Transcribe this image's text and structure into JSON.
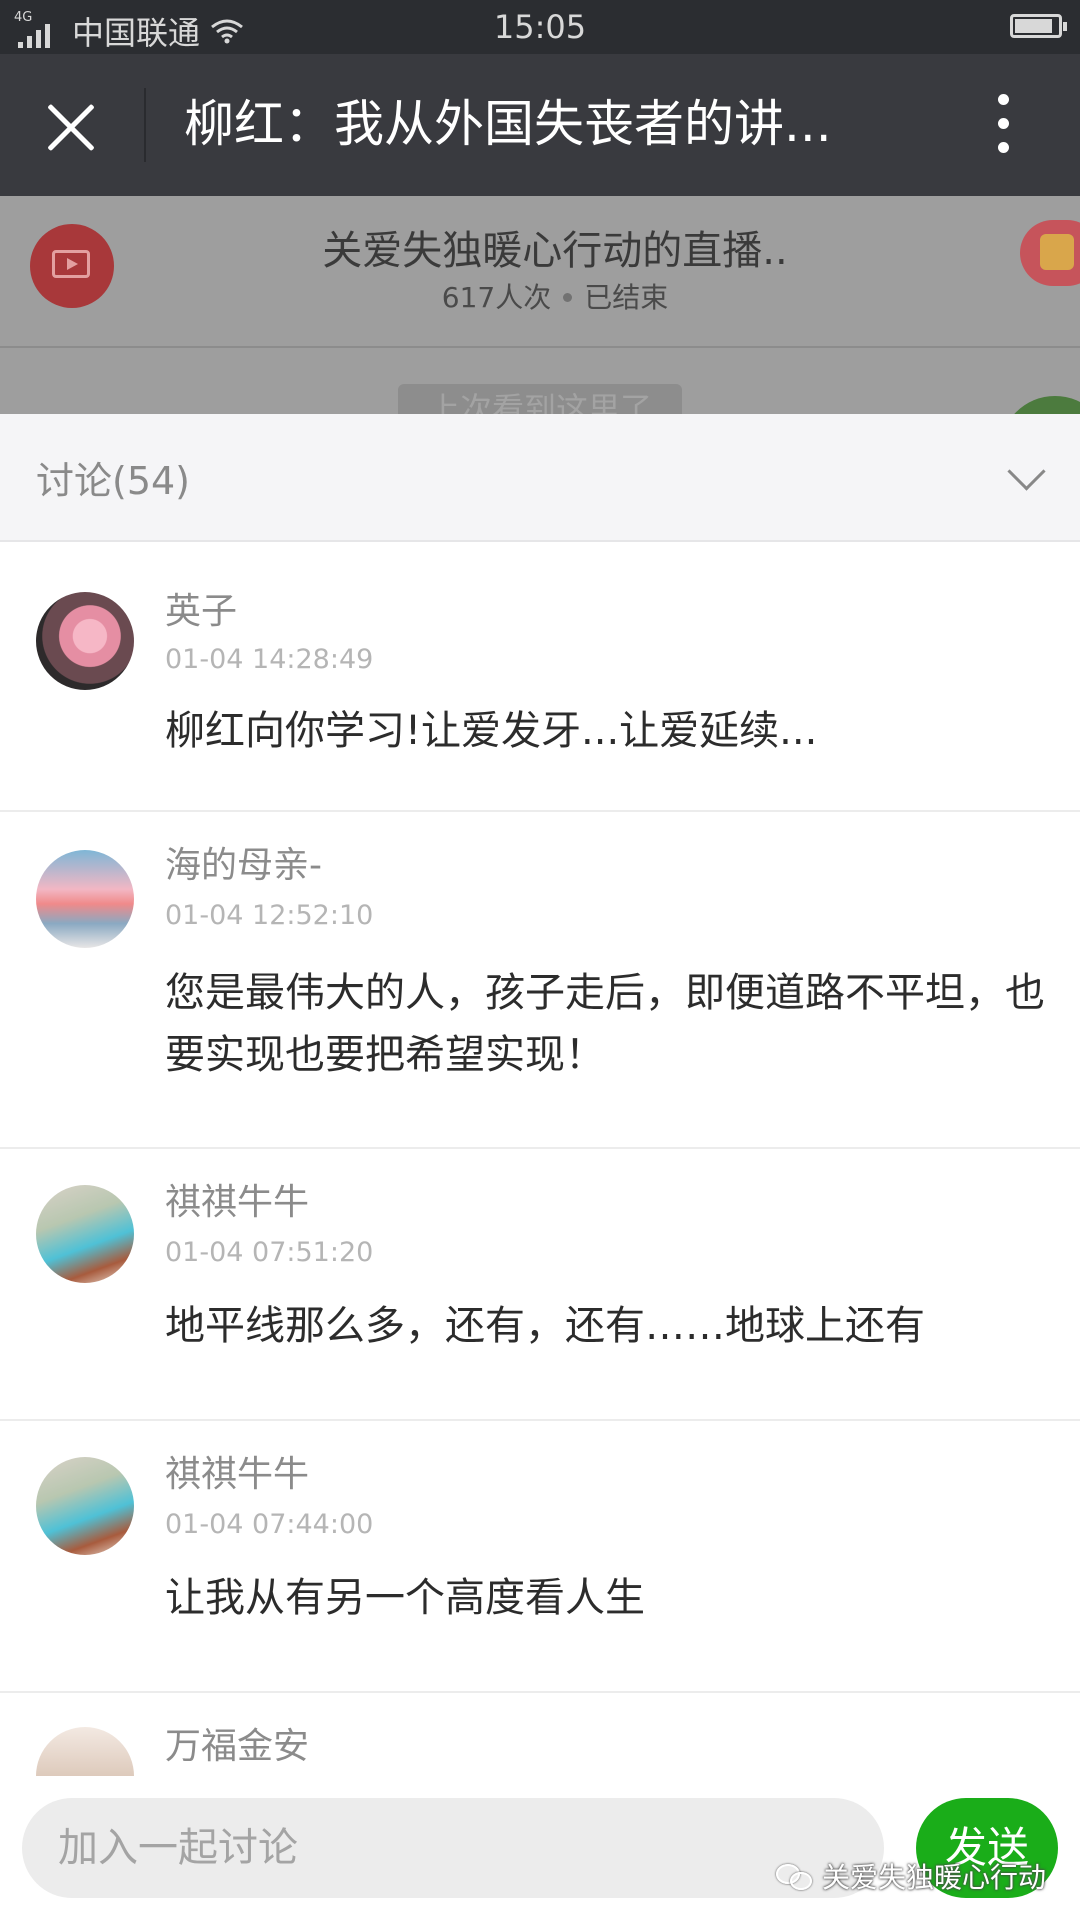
{
  "status_bar": {
    "network": "4G",
    "carrier": "中国联通",
    "time": "15:05",
    "battery_level": 0.88
  },
  "title_bar": {
    "title": "柳红：我从外国失丧者的讲..."
  },
  "live": {
    "title": "关爱失独暖心行动的直播..",
    "viewers": "617人次",
    "status": "已结束",
    "last_seen": "上次看到这里了"
  },
  "discussion": {
    "header": "讨论(54)",
    "comments": [
      {
        "name": "英子",
        "time": "01-04 14:28:49",
        "text": "柳红向你学习!让爱发牙...让爱延续..."
      },
      {
        "name": "海的母亲-",
        "time": "01-04 12:52:10",
        "text": "您是最伟大的人，孩子走后，即便道路不平坦，也要实现也要把希望实现！"
      },
      {
        "name": "祺祺牛牛",
        "time": "01-04 07:51:20",
        "text": "地平线那么多，还有，还有……地球上还有"
      },
      {
        "name": "祺祺牛牛",
        "time": "01-04 07:44:00",
        "text": "让我从有另一个高度看人生"
      },
      {
        "name": "万福金安",
        "time": "",
        "text": ""
      }
    ]
  },
  "input": {
    "placeholder": "加入一起讨论",
    "send_label": "发送"
  },
  "watermark": "关爱失独暖心行动"
}
